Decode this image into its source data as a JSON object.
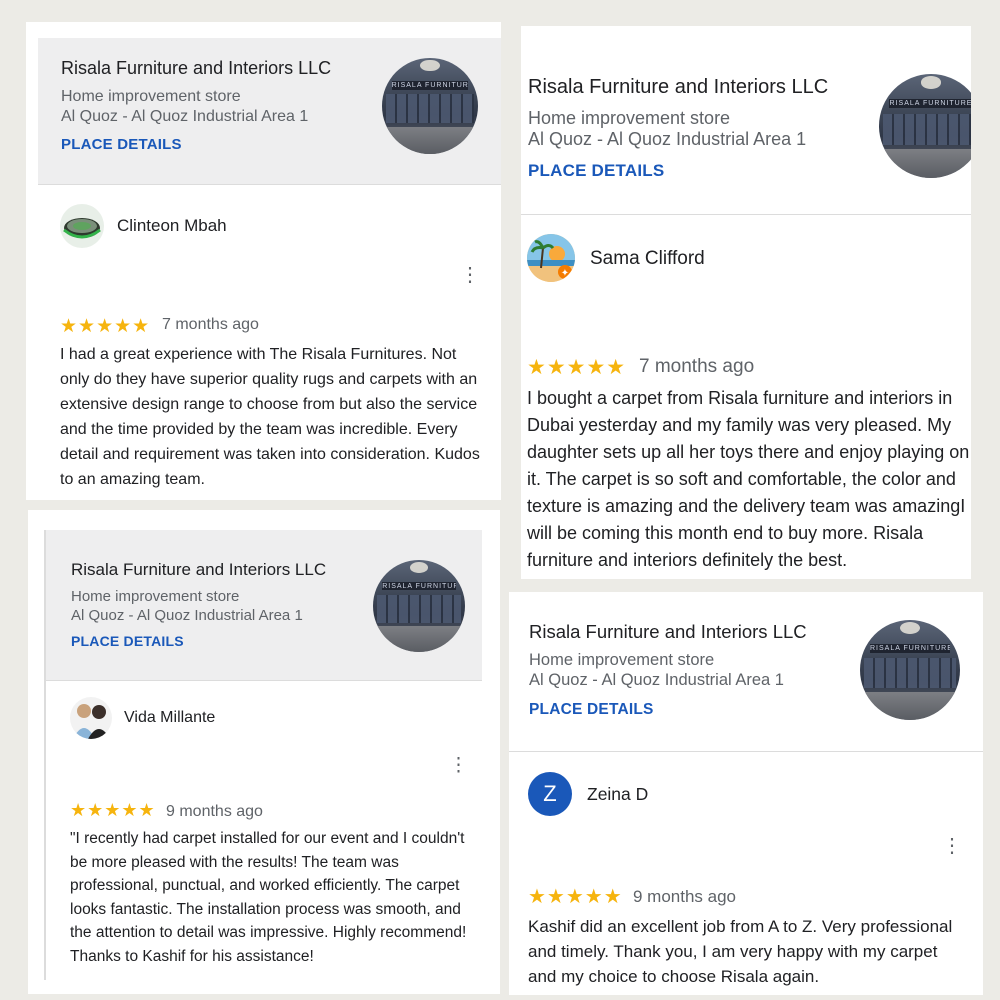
{
  "place": {
    "name": "Risala Furniture and Interiors LLC",
    "category": "Home improvement store",
    "address": "Al Quoz - Al Quoz Industrial Area 1",
    "details_link": "PLACE DETAILS",
    "photo_sign": "RISALA FURNITURE"
  },
  "reviews": [
    {
      "reviewer": "Clinteon Mbah",
      "rating": 5,
      "stars": "★★★★★",
      "time_ago": "7 months ago",
      "text": "I had a great experience with The Risala Furnitures. Not only do they have superior quality rugs and carpets with an extensive design range to choose from but also the service and the time provided by the team was incredible. Every detail and requirement was taken into consideration. Kudos to an amazing team."
    },
    {
      "reviewer": "Sama Clifford",
      "rating": 5,
      "stars": "★★★★★",
      "time_ago": "7 months ago",
      "text": "I bought a carpet from Risala furniture and interiors in Dubai yesterday and my family was very pleased. My daughter sets up all her toys there and enjoy playing on it. The carpet is so soft and comfortable, the color and texture is amazing and the delivery team was amazingI will be coming this month end to buy more. Risala furniture and interiors definitely the best."
    },
    {
      "reviewer": "Vida Millante",
      "rating": 5,
      "stars": "★★★★★",
      "time_ago": "9 months ago",
      "text": "\"I recently had carpet installed for our event and I couldn't be more pleased with the results! The team was professional, punctual, and worked efficiently. The carpet looks fantastic. The installation process was smooth, and the attention to detail was impressive. Highly recommend! Thanks to Kashif for his assistance!"
    },
    {
      "reviewer": "Zeina D",
      "avatar_letter": "Z",
      "rating": 5,
      "stars": "★★★★★",
      "time_ago": "9 months ago",
      "text": "Kashif did an excellent job from A to Z. Very professional and timely. Thank you, I am very happy with my carpet and my choice to choose Risala again."
    }
  ],
  "menu_glyph": "⋮",
  "colors": {
    "background": "#ecebe6",
    "star": "#f6b40e",
    "link": "#1a58b9",
    "header_gray": "#eeeeef",
    "avatar_z": "#1a58b9"
  }
}
